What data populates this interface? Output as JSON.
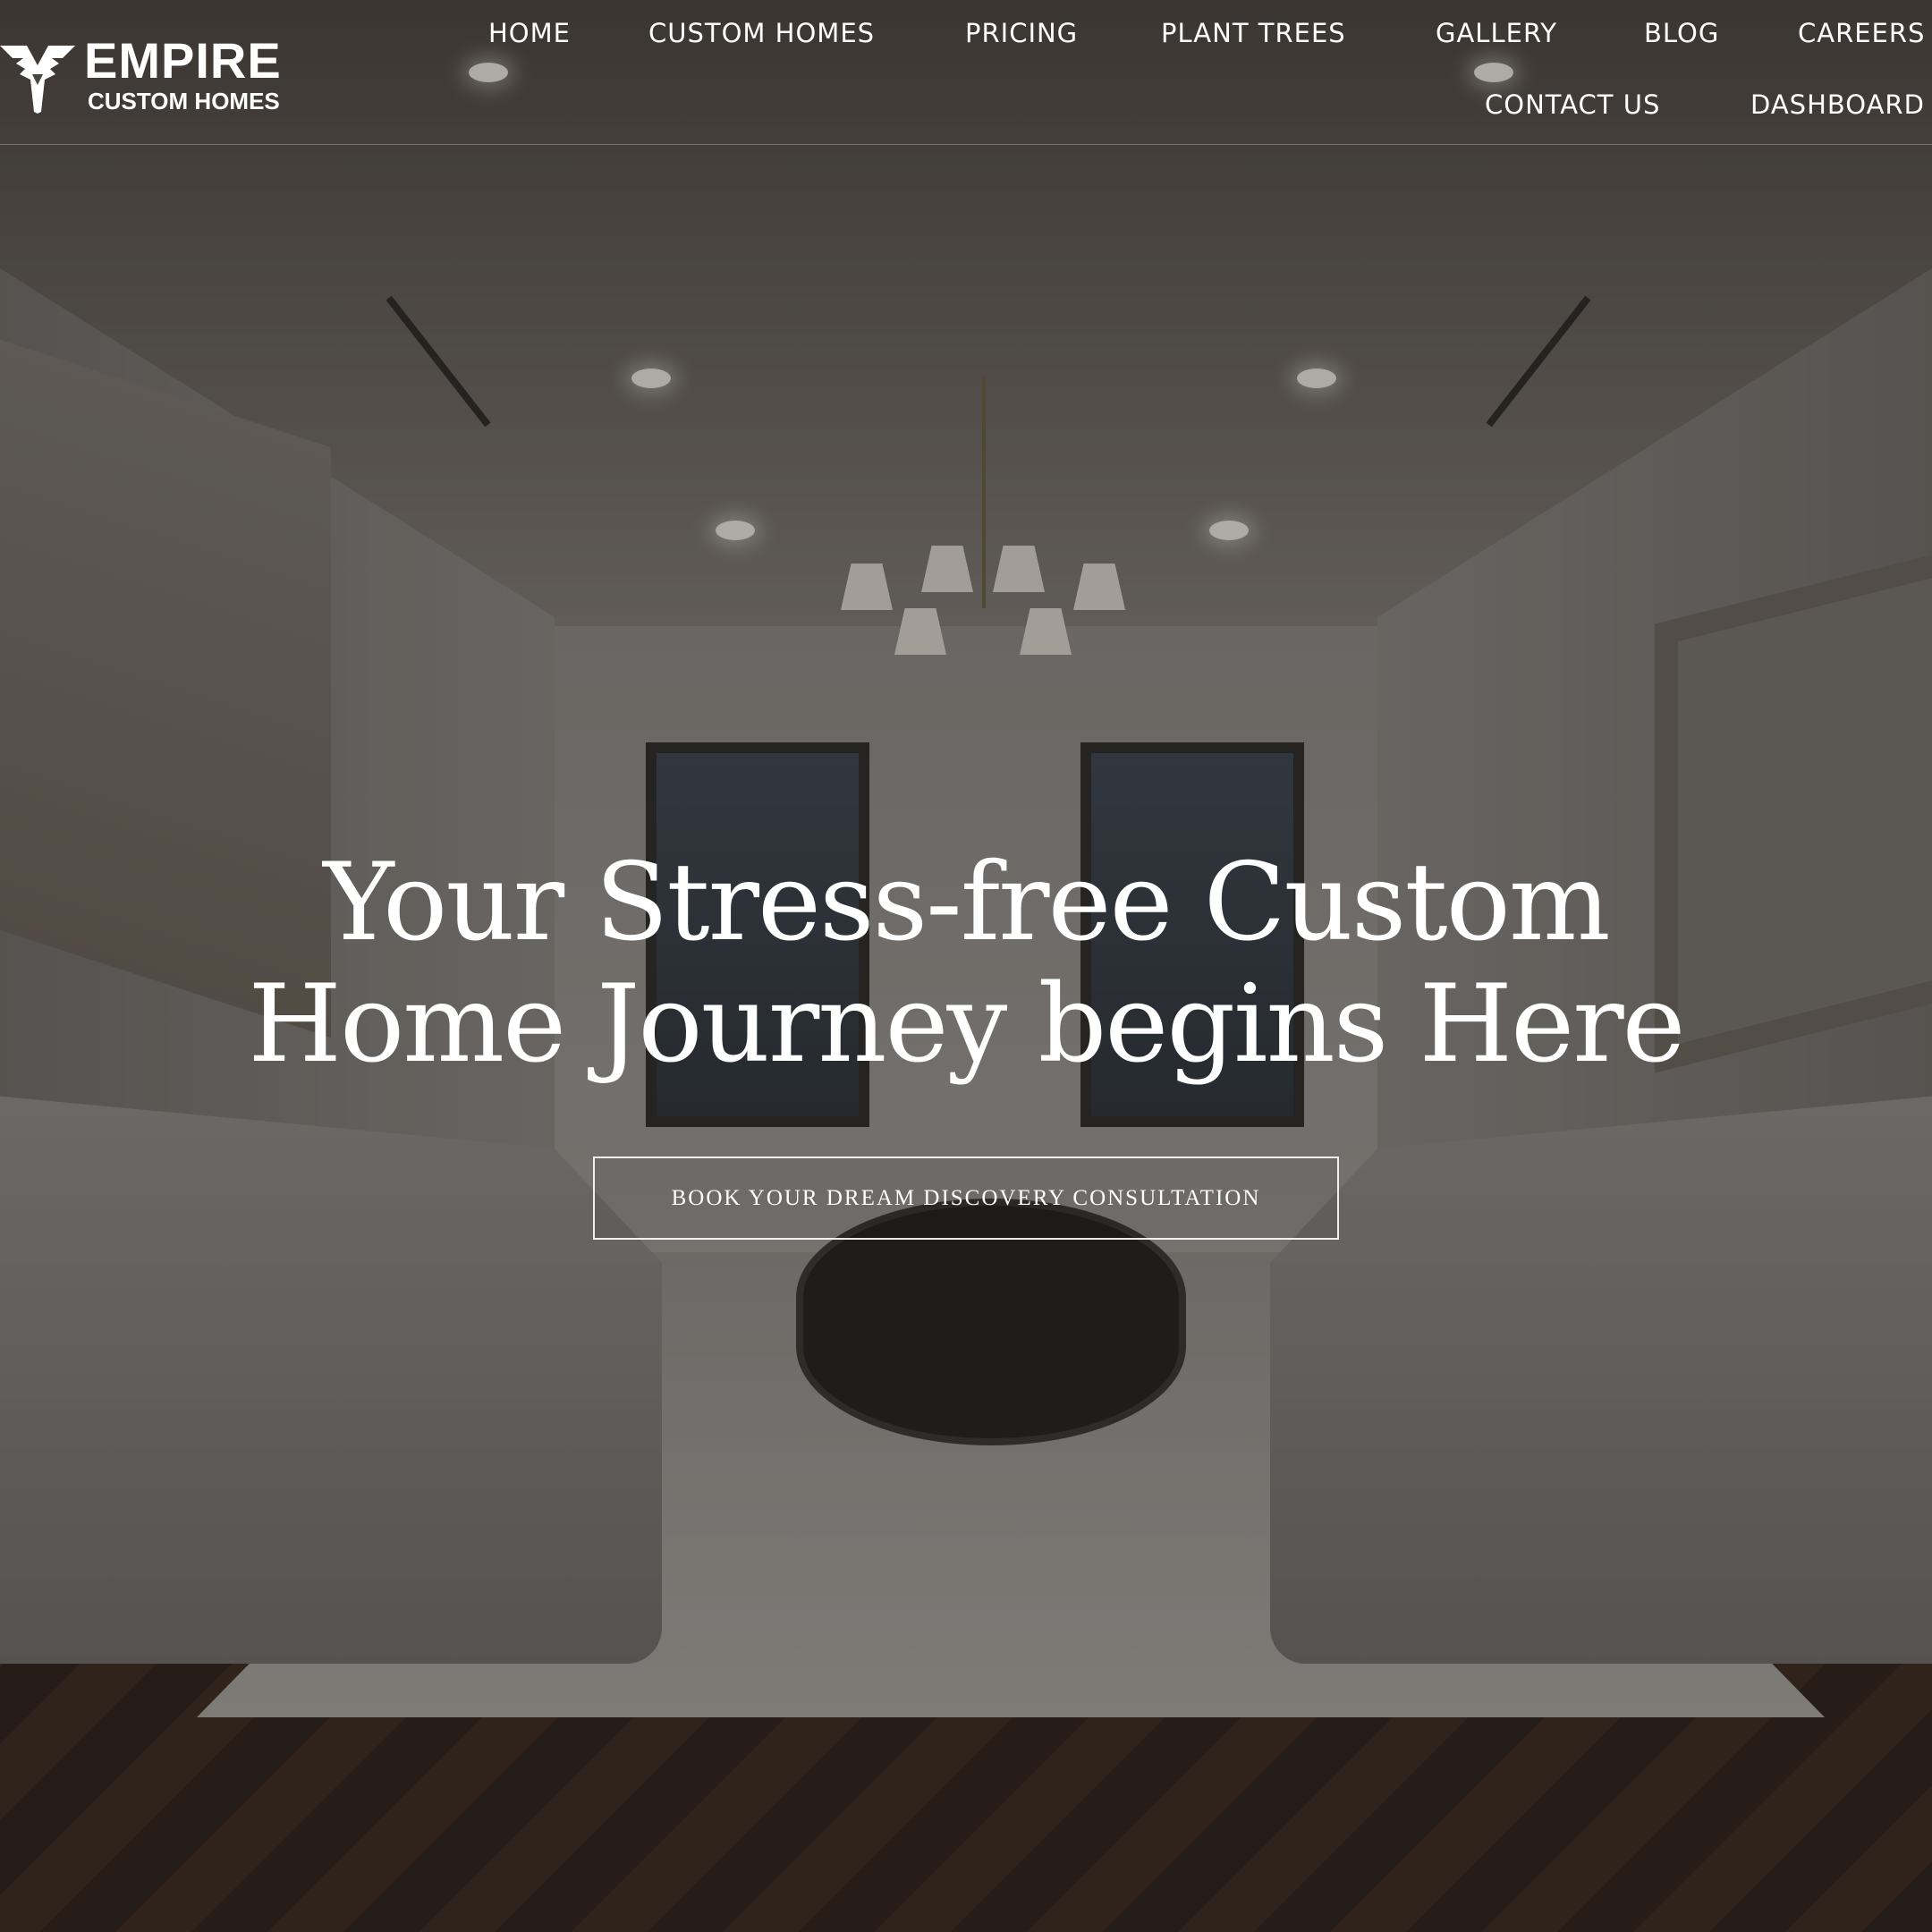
{
  "brand": {
    "name": "EMPIRE",
    "subtitle": "CUSTOM HOMES",
    "logo_icon": "eagle-wings-icon"
  },
  "nav": {
    "items": [
      {
        "label": "HOME"
      },
      {
        "label": "CUSTOM HOMES"
      },
      {
        "label": "PRICING"
      },
      {
        "label": "PLANT TREES"
      },
      {
        "label": "GALLERY"
      },
      {
        "label": "BLOG"
      },
      {
        "label": "CAREERS"
      },
      {
        "label": "CONTACT US"
      },
      {
        "label": "DASHBOARD"
      }
    ]
  },
  "hero": {
    "headline_line1": "Your Stress-free Custom",
    "headline_line2": "Home Journey begins Here",
    "cta_label": "BOOK YOUR DREAM DISCOVERY CONSULTATION"
  },
  "colors": {
    "text": "#ffffff",
    "overlay": "#141210"
  }
}
